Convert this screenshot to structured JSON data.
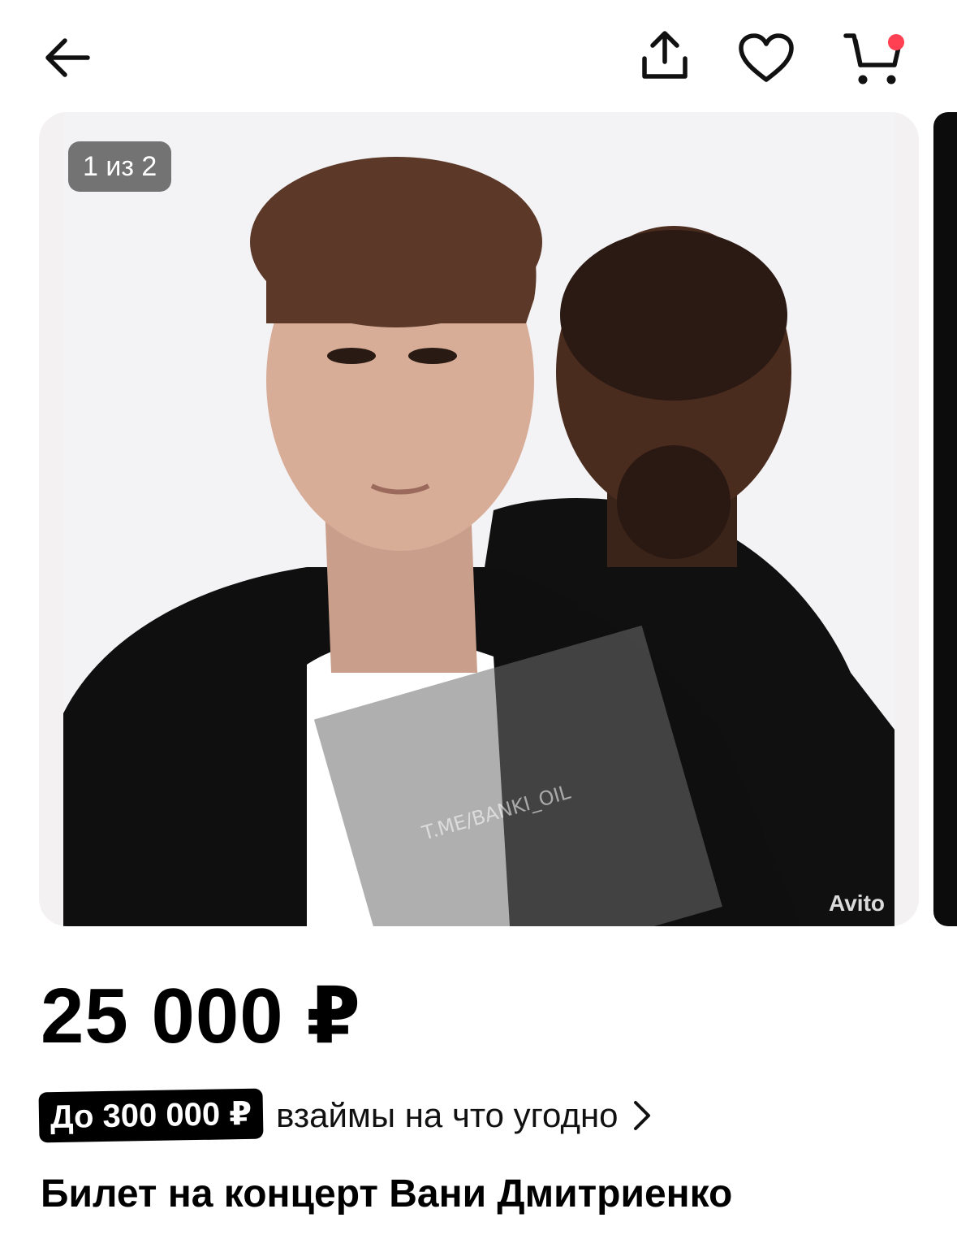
{
  "header": {
    "back_icon": "arrow-left-icon",
    "share_icon": "share-upload-icon",
    "favorite_icon": "heart-icon",
    "cart_icon": "cart-icon",
    "cart_has_notification": true,
    "notification_color": "#ff4053"
  },
  "gallery": {
    "counter": "1 из 2",
    "watermark_text": "Avito",
    "overlay_watermark": "T.ME/BANKI_OIL"
  },
  "listing": {
    "price": "25 000 ₽",
    "promo_badge": "До 300 000 ₽",
    "promo_text": "взаймы на что угодно",
    "promo_chevron_icon": "chevron-right-icon",
    "title": "Билет на концерт Вани Дмитриенко"
  }
}
